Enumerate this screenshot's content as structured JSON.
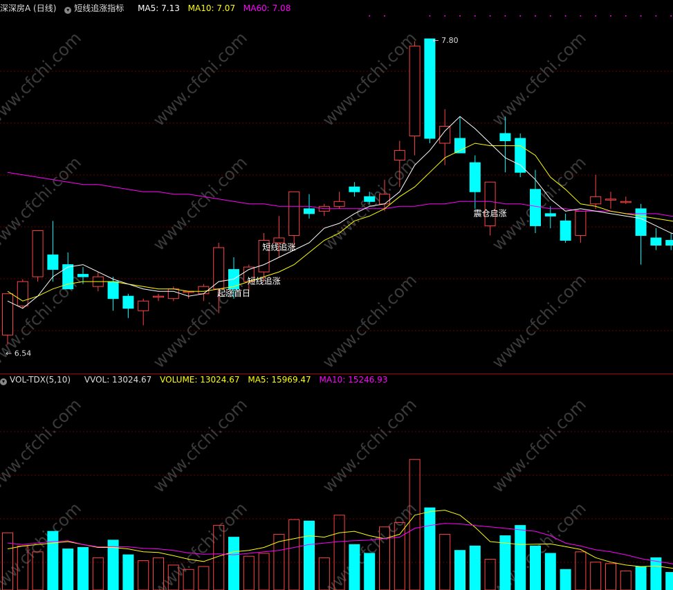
{
  "header": {
    "stock_name": "深深房A (日线)",
    "indicator_name": "短线追涨指标",
    "ma5": "MA5: 7.13",
    "ma10": "MA10: 7.07",
    "ma60": "MA60: 7.08",
    "volume_indicator": "VOL-TDX(5,10)",
    "vvol": "VVOL: 13024.67",
    "volume": "VOLUME: 13024.67",
    "vol_ma5": "MA5: 15969.47",
    "vol_ma10": "MA10: 15246.93"
  },
  "colors": {
    "up": "#ff4444",
    "down": "#00ffff",
    "ma5": "#ffffff",
    "ma10": "#ffff00",
    "ma60": "#ff00ff",
    "grid": "#6a0000",
    "divider": "#a00000"
  },
  "watermark": "www.cfchi.com",
  "chart_data": [
    {
      "type": "candlestick",
      "title": "深深房A (日线)",
      "ylim": [
        6.45,
        7.92
      ],
      "high_label": "7.80",
      "low_label": "6.54",
      "candles": [
        {
          "o": 6.58,
          "h": 6.75,
          "l": 6.54,
          "c": 6.75
        },
        {
          "o": 6.7,
          "h": 6.81,
          "l": 6.69,
          "c": 6.8
        },
        {
          "o": 6.82,
          "h": 7.0,
          "l": 6.8,
          "c": 7.01
        },
        {
          "o": 6.91,
          "h": 7.05,
          "l": 6.8,
          "c": 6.85
        },
        {
          "o": 6.87,
          "h": 6.92,
          "l": 6.77,
          "c": 6.77
        },
        {
          "o": 6.83,
          "h": 6.86,
          "l": 6.79,
          "c": 6.82
        },
        {
          "o": 6.78,
          "h": 6.84,
          "l": 6.76,
          "c": 6.82
        },
        {
          "o": 6.8,
          "h": 6.82,
          "l": 6.68,
          "c": 6.73
        },
        {
          "o": 6.74,
          "h": 6.75,
          "l": 6.65,
          "c": 6.69
        },
        {
          "o": 6.68,
          "h": 6.73,
          "l": 6.62,
          "c": 6.72
        },
        {
          "o": 6.74,
          "h": 6.75,
          "l": 6.72,
          "c": 6.74
        },
        {
          "o": 6.73,
          "h": 6.78,
          "l": 6.72,
          "c": 6.77
        },
        {
          "o": 6.76,
          "h": 6.76,
          "l": 6.73,
          "c": 6.76
        },
        {
          "o": 6.75,
          "h": 6.79,
          "l": 6.72,
          "c": 6.78
        },
        {
          "o": 6.77,
          "h": 6.96,
          "l": 6.67,
          "c": 6.94
        },
        {
          "o": 6.85,
          "h": 6.9,
          "l": 6.73,
          "c": 6.77
        },
        {
          "o": 6.8,
          "h": 6.87,
          "l": 6.76,
          "c": 6.86
        },
        {
          "o": 6.84,
          "h": 7.0,
          "l": 6.8,
          "c": 6.97
        },
        {
          "o": 6.96,
          "h": 7.07,
          "l": 6.9,
          "c": 6.98
        },
        {
          "o": 6.99,
          "h": 7.16,
          "l": 6.94,
          "c": 7.17
        },
        {
          "o": 7.1,
          "h": 7.16,
          "l": 7.06,
          "c": 7.08
        },
        {
          "o": 7.09,
          "h": 7.12,
          "l": 7.07,
          "c": 7.11
        },
        {
          "o": 7.11,
          "h": 7.17,
          "l": 7.1,
          "c": 7.13
        },
        {
          "o": 7.19,
          "h": 7.21,
          "l": 7.15,
          "c": 7.17
        },
        {
          "o": 7.15,
          "h": 7.17,
          "l": 7.12,
          "c": 7.13
        },
        {
          "o": 7.12,
          "h": 7.22,
          "l": 7.09,
          "c": 7.16
        },
        {
          "o": 7.3,
          "h": 7.38,
          "l": 7.19,
          "c": 7.34
        },
        {
          "o": 7.4,
          "h": 7.79,
          "l": 7.32,
          "c": 7.77
        },
        {
          "o": 7.8,
          "h": 7.8,
          "l": 7.37,
          "c": 7.39
        },
        {
          "o": 7.37,
          "h": 7.51,
          "l": 7.28,
          "c": 7.44
        },
        {
          "o": 7.39,
          "h": 7.48,
          "l": 7.33,
          "c": 7.33
        },
        {
          "o": 7.29,
          "h": 7.32,
          "l": 7.1,
          "c": 7.17
        },
        {
          "o": 7.03,
          "h": 7.2,
          "l": 6.99,
          "c": 7.21
        },
        {
          "o": 7.41,
          "h": 7.48,
          "l": 7.25,
          "c": 7.38
        },
        {
          "o": 7.39,
          "h": 7.41,
          "l": 7.23,
          "c": 7.25
        },
        {
          "o": 7.18,
          "h": 7.26,
          "l": 7.0,
          "c": 7.03
        },
        {
          "o": 7.08,
          "h": 7.11,
          "l": 7.02,
          "c": 7.07
        },
        {
          "o": 7.05,
          "h": 7.08,
          "l": 6.96,
          "c": 6.97
        },
        {
          "o": 6.99,
          "h": 7.09,
          "l": 6.96,
          "c": 7.09
        },
        {
          "o": 7.12,
          "h": 7.24,
          "l": 7.1,
          "c": 7.15
        },
        {
          "o": 7.14,
          "h": 7.17,
          "l": 7.1,
          "c": 7.14
        },
        {
          "o": 7.13,
          "h": 7.15,
          "l": 7.12,
          "c": 7.13
        },
        {
          "o": 7.1,
          "h": 7.12,
          "l": 6.87,
          "c": 6.99
        },
        {
          "o": 6.98,
          "h": 7.02,
          "l": 6.93,
          "c": 6.95
        },
        {
          "o": 6.97,
          "h": 7.0,
          "l": 6.93,
          "c": 6.95
        },
        {
          "o": 6.97,
          "h": 7.04,
          "l": 6.94,
          "c": 7.01
        },
        {
          "o": 7.02,
          "h": 7.05,
          "l": 6.95,
          "c": 6.98
        }
      ],
      "ma5": [
        6.72,
        6.69,
        6.74,
        6.82,
        6.86,
        6.87,
        6.84,
        6.81,
        6.79,
        6.77,
        6.76,
        6.76,
        6.74,
        6.75,
        6.8,
        6.81,
        6.85,
        6.87,
        6.9,
        6.93,
        6.96,
        7.02,
        7.04,
        7.08,
        7.11,
        7.12,
        7.17,
        7.28,
        7.34,
        7.42,
        7.48,
        7.43,
        7.37,
        7.31,
        7.28,
        7.22,
        7.14,
        7.09,
        7.1,
        7.09,
        7.08,
        7.07,
        7.06,
        7.03,
        7.0,
        6.98,
        6.97
      ],
      "ma10": [
        6.76,
        6.72,
        6.74,
        6.77,
        6.79,
        6.8,
        6.8,
        6.8,
        6.79,
        6.78,
        6.77,
        6.77,
        6.76,
        6.76,
        6.77,
        6.78,
        6.8,
        6.82,
        6.84,
        6.87,
        6.92,
        6.97,
        7.0,
        7.05,
        7.07,
        7.1,
        7.15,
        7.19,
        7.25,
        7.31,
        7.34,
        7.37,
        7.36,
        7.36,
        7.36,
        7.32,
        7.23,
        7.18,
        7.12,
        7.11,
        7.09,
        7.08,
        7.07,
        7.06,
        7.05,
        7.04,
        7.03
      ],
      "ma60": [
        7.25,
        7.24,
        7.23,
        7.22,
        7.21,
        7.2,
        7.2,
        7.19,
        7.18,
        7.17,
        7.17,
        7.16,
        7.16,
        7.15,
        7.14,
        7.13,
        7.12,
        7.12,
        7.11,
        7.11,
        7.11,
        7.1,
        7.1,
        7.1,
        7.1,
        7.1,
        7.11,
        7.11,
        7.12,
        7.12,
        7.13,
        7.13,
        7.13,
        7.12,
        7.12,
        7.11,
        7.1,
        7.1,
        7.09,
        7.09,
        7.09,
        7.08,
        7.08,
        7.08,
        7.07,
        7.07,
        7.08
      ],
      "annotations": [
        {
          "index": 15,
          "price": 6.74,
          "text": "起涨首日"
        },
        {
          "index": 17,
          "price": 6.79,
          "text": "短线追涨"
        },
        {
          "index": 18,
          "price": 6.93,
          "text": "短线追涨"
        },
        {
          "index": 32,
          "price": 7.07,
          "text": "震仓启涨"
        }
      ]
    },
    {
      "type": "bar",
      "title": "VOL-TDX(5,10)",
      "ylim": [
        0,
        70000
      ],
      "volume": [
        19500,
        15000,
        13000,
        20000,
        14000,
        14500,
        11000,
        17000,
        12000,
        10000,
        11000,
        8500,
        7000,
        8000,
        22000,
        18000,
        11500,
        12500,
        19000,
        24000,
        23500,
        11000,
        25500,
        15500,
        12500,
        21500,
        23000,
        44500,
        28000,
        19000,
        13500,
        15000,
        10500,
        18500,
        22000,
        15000,
        12500,
        7000,
        13000,
        9500,
        9000,
        6500,
        8000,
        11000,
        6000,
        3500,
        3000
      ],
      "vol_ma5": [
        14000,
        15000,
        15500,
        16000,
        16500,
        15500,
        14500,
        14500,
        14000,
        13000,
        12800,
        11700,
        10500,
        9700,
        11500,
        13000,
        13500,
        14500,
        16500,
        17500,
        18500,
        18000,
        19500,
        20000,
        18500,
        17500,
        19000,
        25500,
        26700,
        27200,
        25500,
        21400,
        16500,
        16000,
        15500,
        15600,
        15700,
        14800,
        13800,
        11000,
        9500,
        8500,
        8000,
        8200,
        7500,
        6500,
        5500
      ],
      "vol_ma10": [
        16000,
        15500,
        16000,
        16500,
        16800,
        15500,
        14700,
        14800,
        14700,
        14200,
        14000,
        13500,
        12600,
        12200,
        12300,
        12000,
        12500,
        13000,
        13500,
        14500,
        15500,
        16000,
        16500,
        16800,
        17000,
        17500,
        18000,
        21000,
        22000,
        22700,
        22500,
        22000,
        21500,
        21000,
        20500,
        20000,
        18500,
        16000,
        15000,
        13700,
        13000,
        12000,
        10700,
        9800,
        9000,
        8000,
        7000
      ]
    }
  ]
}
